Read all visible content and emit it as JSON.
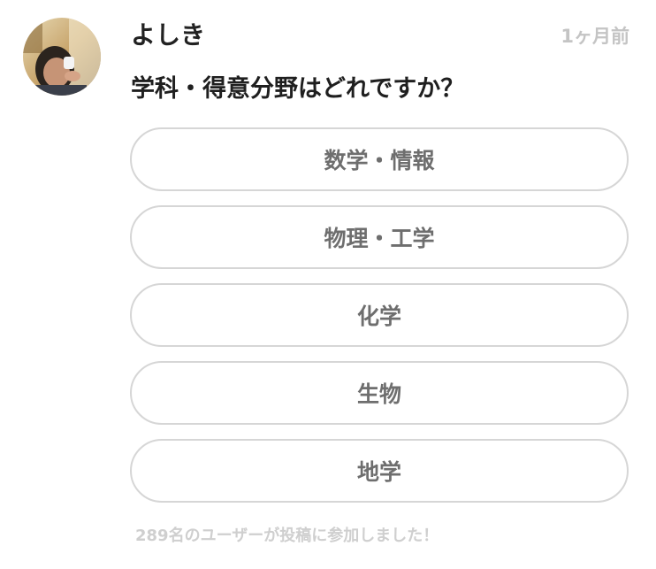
{
  "post": {
    "username": "よしき",
    "timestamp": "1ヶ月前",
    "question": "学科・得意分野はどれですか？",
    "options": [
      {
        "label": "数学・情報"
      },
      {
        "label": "物理・工学"
      },
      {
        "label": "化学"
      },
      {
        "label": "生物"
      },
      {
        "label": "地学"
      }
    ],
    "footer": "289名のユーザーが投稿に参加しました！"
  },
  "colors": {
    "title_text": "#222222",
    "option_text": "#6e6e6e",
    "option_border": "#d6d6d6",
    "muted_text": "#c4c4c4"
  }
}
